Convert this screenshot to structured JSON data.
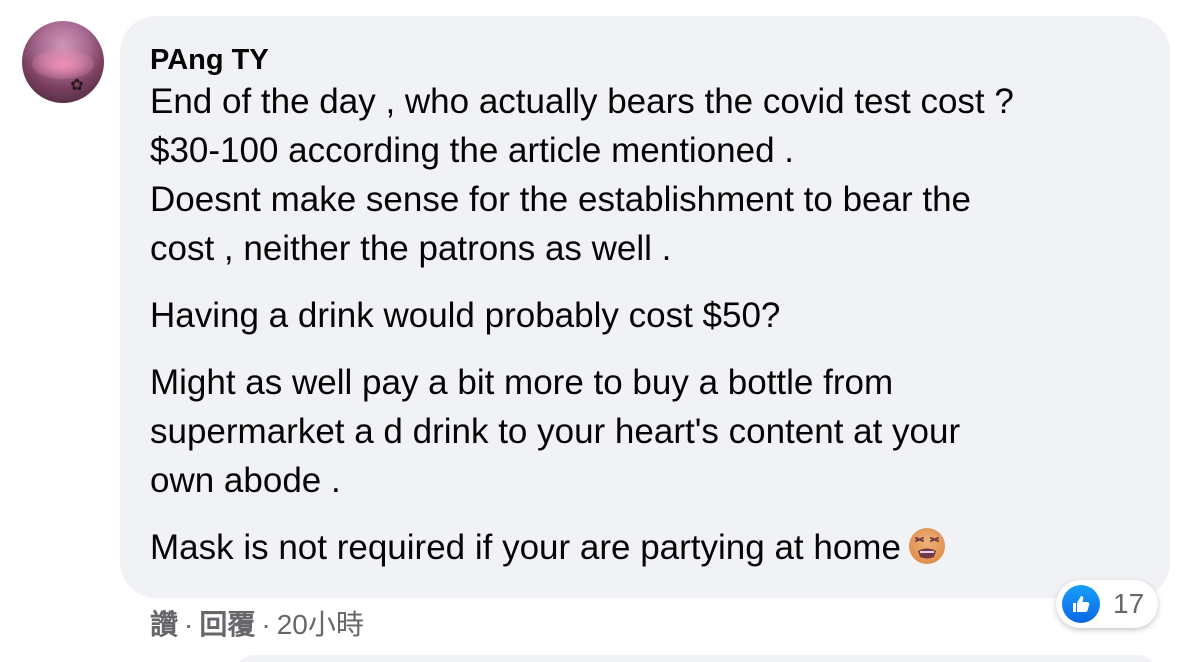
{
  "comment": {
    "author": "PAng TY",
    "paragraphs": [
      {
        "lines": [
          "End of the day , who actually bears the covid test cost ?",
          "$30-100 according the article mentioned .",
          "Doesnt make sense for the establishment to bear the",
          "cost , neither the patrons as well ."
        ]
      },
      {
        "lines": [
          "Having a drink would probably cost $50?"
        ]
      },
      {
        "lines": [
          "Might as well pay a bit more to buy a bottle from",
          "supermarket a d drink to your heart's content at your",
          "own abode ."
        ]
      },
      {
        "lines": [
          "Mask is not required if your are partying at home"
        ]
      }
    ],
    "emoji": "face-with-crossed-out-eyes-emoji"
  },
  "reactions": {
    "icon": "thumbs-up-icon",
    "count": "17",
    "color": "#1877f2"
  },
  "actions": {
    "like": "讚",
    "separator": "·",
    "reply": "回覆",
    "time": "20小時"
  },
  "colors": {
    "bubble": "#f0f2f5",
    "text": "#050505",
    "secondary": "#65676b"
  }
}
